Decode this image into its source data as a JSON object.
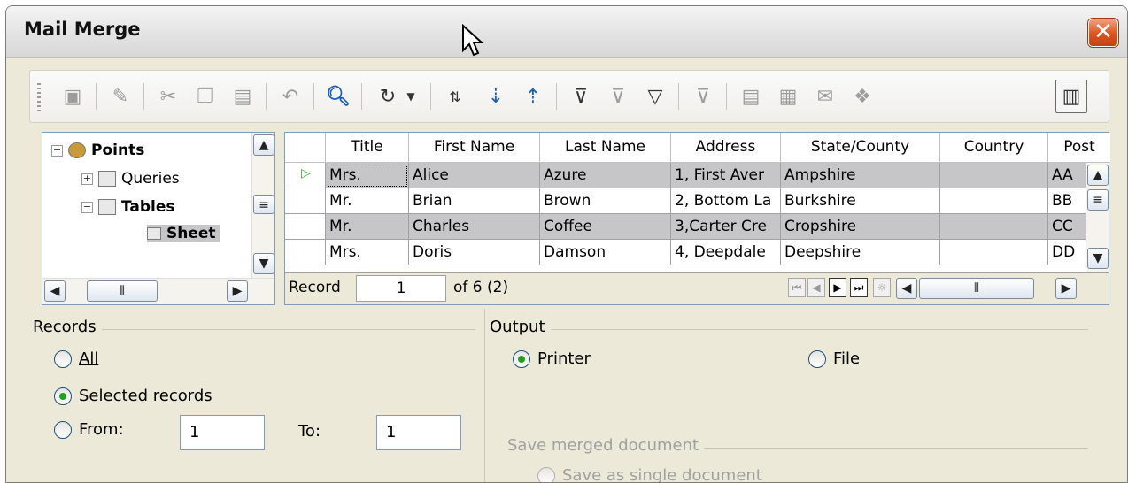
{
  "window": {
    "title": "Mail Merge",
    "close_symbol": "✕"
  },
  "toolbar": {
    "icons": [
      "save-icon",
      "edit-icon",
      "cut-icon",
      "copy-icon",
      "paste-icon",
      "undo-icon",
      "find-record-icon",
      "refresh-icon",
      "dropdown-arrow",
      "sort-icon",
      "sort-ascending-icon",
      "sort-descending-icon",
      "autofilter-icon",
      "apply-filter-icon",
      "standard-filter-icon",
      "remove-filter-icon",
      "data-to-text-icon",
      "data-to-fields-icon",
      "mail-merge-icon",
      "explorer-icon"
    ]
  },
  "tree": {
    "items": [
      {
        "label": "Points",
        "bold": true
      },
      {
        "label": "Queries",
        "bold": false
      },
      {
        "label": "Tables",
        "bold": true
      },
      {
        "label": "Sheet",
        "bold": true
      }
    ]
  },
  "grid": {
    "columns": [
      "Title",
      "First Name",
      "Last Name",
      "Address",
      "State/County",
      "Country",
      "Post"
    ],
    "rows": [
      [
        "Mrs.",
        "Alice",
        "Azure",
        "1, First Aver",
        "Ampshire",
        "",
        "AA"
      ],
      [
        "Mr.",
        "Brian",
        "Brown",
        "2, Bottom La",
        "Burkshire",
        "",
        "BB"
      ],
      [
        "Mr.",
        "Charles",
        "Coffee",
        "3,Carter Cre",
        "Cropshire",
        "",
        "CC"
      ],
      [
        "Mrs.",
        "Doris",
        "Damson",
        "4, Deepdale",
        "Deepshire",
        "",
        "DD"
      ]
    ],
    "record_label": "Record",
    "record_value": "1",
    "record_of": "of 6 (2)"
  },
  "records": {
    "label": "Records",
    "all": "All",
    "selected": "Selected records",
    "from": "From:",
    "from_value": "1",
    "to": "To:",
    "to_value": "1"
  },
  "output": {
    "label": "Output",
    "printer": "Printer",
    "file": "File",
    "save_merged": "Save merged document",
    "save_single": "Save as single document"
  }
}
